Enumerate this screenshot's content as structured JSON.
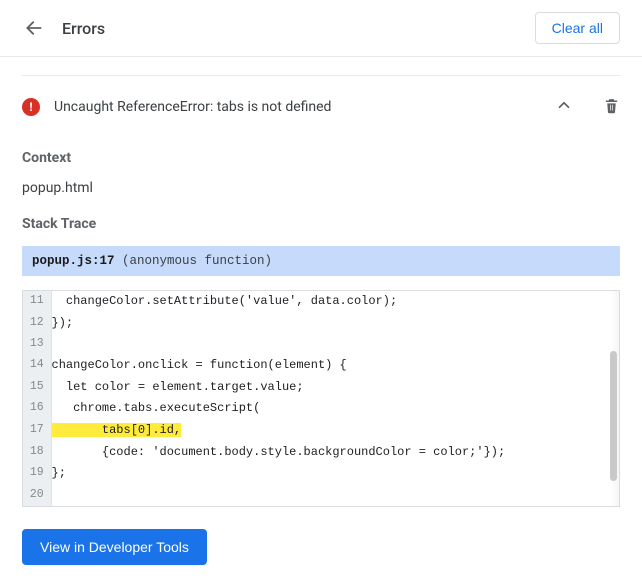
{
  "header": {
    "title": "Errors",
    "clear_all": "Clear all"
  },
  "error": {
    "message": "Uncaught ReferenceError: tabs is not defined"
  },
  "context": {
    "label": "Context",
    "value": "popup.html"
  },
  "stack": {
    "label": "Stack Trace",
    "file": "popup.js:17",
    "func": "(anonymous function)"
  },
  "code": {
    "lines": [
      {
        "n": "11",
        "t": "  changeColor.setAttribute('value', data.color);",
        "hl": false
      },
      {
        "n": "12",
        "t": "});",
        "hl": false
      },
      {
        "n": "13",
        "t": "",
        "hl": false
      },
      {
        "n": "14",
        "t": "changeColor.onclick = function(element) {",
        "hl": false
      },
      {
        "n": "15",
        "t": "  let color = element.target.value;",
        "hl": false
      },
      {
        "n": "16",
        "t": "   chrome.tabs.executeScript(",
        "hl": false
      },
      {
        "n": "17",
        "t": "       tabs[0].id,",
        "hl": true
      },
      {
        "n": "18",
        "t": "       {code: 'document.body.style.backgroundColor = color;'});",
        "hl": false
      },
      {
        "n": "19",
        "t": "};",
        "hl": false
      },
      {
        "n": "20",
        "t": "",
        "hl": false
      }
    ]
  },
  "devtools_btn": "View in Developer Tools"
}
